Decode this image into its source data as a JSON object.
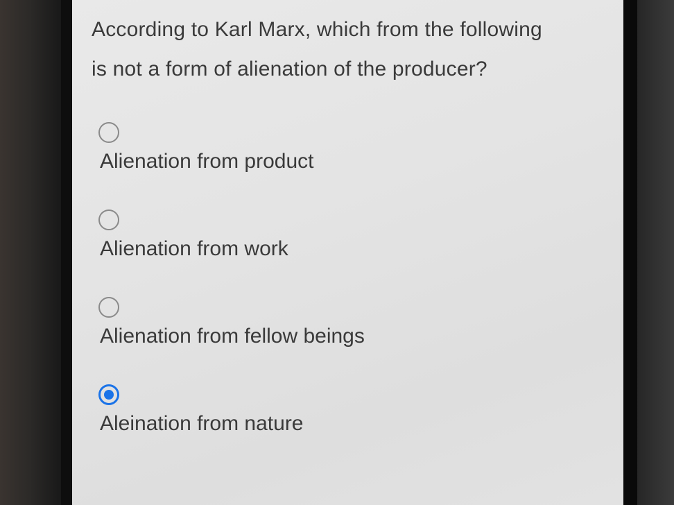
{
  "question": {
    "text_line1": "According to Karl Marx, which from the following",
    "text_line2": "is not a form of alienation of the producer?"
  },
  "options": [
    {
      "label": "Alienation from product",
      "selected": false
    },
    {
      "label": "Alienation from work",
      "selected": false
    },
    {
      "label": "Alienation from fellow beings",
      "selected": false
    },
    {
      "label": "Aleination from nature",
      "selected": true
    }
  ],
  "colors": {
    "accent": "#1a73e8",
    "text": "#3a3a3a",
    "radio_border": "#8a8a8a"
  }
}
